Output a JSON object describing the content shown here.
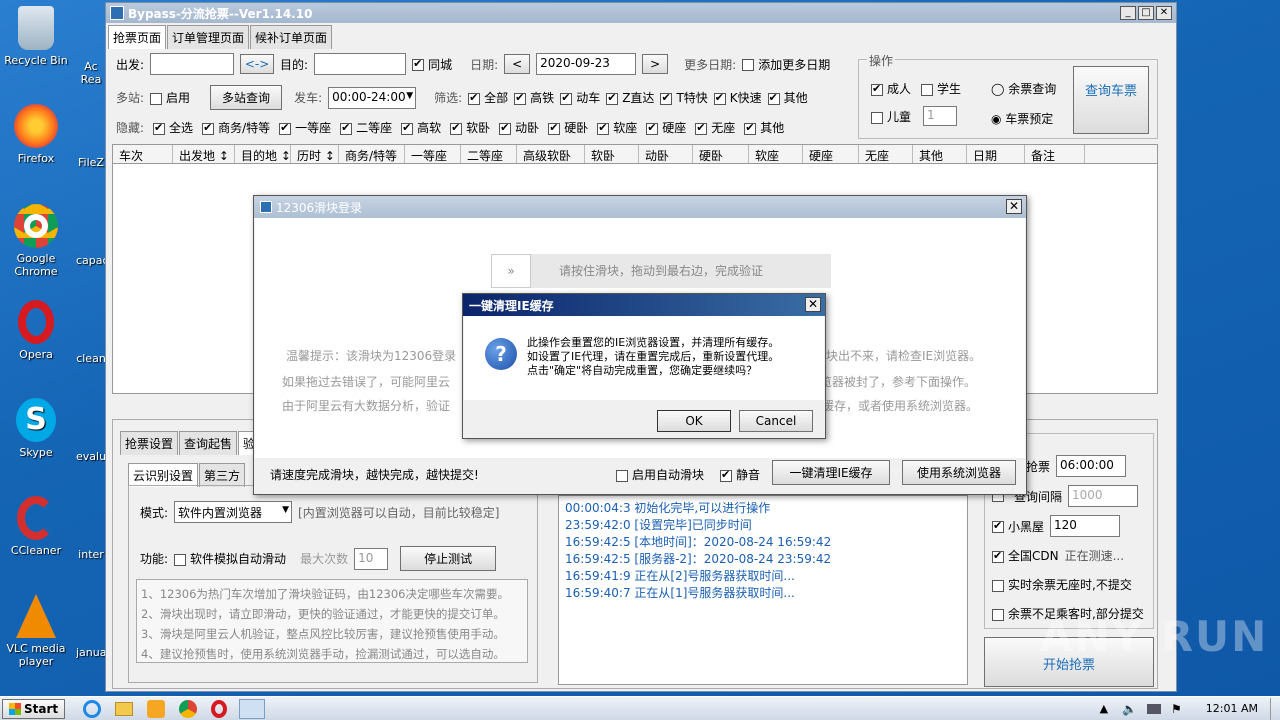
{
  "desktop": {
    "icons": [
      {
        "label": "Recycle Bin",
        "icon": "recycle-bin-icon"
      },
      {
        "label": "Firefox",
        "icon": "firefox-icon"
      },
      {
        "label": "Google Chrome",
        "icon": "chrome-icon"
      },
      {
        "label": "Opera",
        "icon": "opera-icon"
      },
      {
        "label": "Skype",
        "icon": "skype-icon"
      },
      {
        "label": "CCleaner",
        "icon": "ccleaner-icon"
      },
      {
        "label": "VLC media player",
        "icon": "vlc-icon"
      }
    ],
    "icons2": [
      "Ac Rea",
      "FileZ",
      "capac",
      "clean",
      "evalu",
      "inter",
      "janua"
    ]
  },
  "window": {
    "title": "Bypass-分流抢票--Ver1.14.10",
    "tabs": [
      "抢票页面",
      "订单管理页面",
      "候补订单页面"
    ]
  },
  "search": {
    "from_label": "出发:",
    "swap": "<->",
    "to_label": "目的:",
    "same_city": "同城",
    "date_label": "日期:",
    "date": "2020-09-23",
    "more_dates_label": "更多日期:",
    "add_more_dates": "添加更多日期",
    "multi_station": "多站:",
    "enable": "启用",
    "multi_query": "多站查询",
    "depart_label": "发车:",
    "depart_time": "00:00-24:00",
    "filter_label": "筛选:",
    "filters": [
      "全部",
      "高铁",
      "动车",
      "Z直达",
      "T特快",
      "K快速",
      "其他"
    ],
    "hide_label": "隐藏:",
    "hide_items": [
      "全选",
      "商务/特等",
      "一等座",
      "二等座",
      "高软",
      "软卧",
      "动卧",
      "硬卧",
      "软座",
      "硬座",
      "无座",
      "其他"
    ]
  },
  "ops": {
    "title": "操作",
    "adult": "成人",
    "student": "学生",
    "child": "儿童",
    "child_count": "1",
    "remain_query": "余票查询",
    "book": "车票预定",
    "query_btn": "查询车票"
  },
  "grid": {
    "columns": [
      "车次",
      "出发地 ↕",
      "目的地 ↕",
      "历时 ↕",
      "商务/特等",
      "一等座",
      "二等座",
      "高级软卧",
      "软卧",
      "动卧",
      "硬卧",
      "软座",
      "硬座",
      "无座",
      "其他",
      "日期",
      "备注"
    ]
  },
  "bottom": {
    "tabs": [
      "抢票设置",
      "查询起售",
      "验"
    ],
    "subtabs": [
      "云识别设置",
      "第三方"
    ],
    "mode_label": "模式:",
    "mode_value": "软件内置浏览器",
    "mode_note": "[内置浏览器可以自动，目前比较稳定]",
    "func_label": "功能:",
    "func_auto": "软件模拟自动滑动",
    "max_times_label": "最大次数",
    "max_times": "10",
    "stop_test": "停止测试",
    "notes": [
      "1、12306为热门车次增加了滑块验证码，由12306决定哪些车次需要。",
      "2、滑块出现时，请立即滑动，更快的验证通过，才能更快的提交订单。",
      "3、滑块是阿里云人机验证，整点风控比较厉害，建议抢预售使用手动。",
      "4、建议抢预售时，使用系统浏览器手动，捡漏测试通过，可以选自动。"
    ],
    "logs": [
      "00:00:04:3  初始化完毕,可以进行操作",
      "23:59:42:0  [设置完毕]已同步时间",
      "16:59:42:5  [本地时间]：2020-08-24 16:59:42",
      "16:59:42:5  [服务器-2]：2020-08-24 23:59:42",
      "16:59:41:9  正在从[2]号服务器获取时间...",
      "16:59:40:7  正在从[1]号服务器获取时间..."
    ],
    "right": {
      "grab_label": "抢票",
      "grab_time": "06:00:00",
      "interval_label": "查询间隔",
      "interval": "1000",
      "blackroom": "小黑屋",
      "blackroom_val": "120",
      "cdn": "全国CDN",
      "cdn_status": "正在测速...",
      "realtime": "实时余票无座时,不提交",
      "partial": "余票不足乘客时,部分提交",
      "start": "开始抢票"
    }
  },
  "slider": {
    "title": "12306滑块登录",
    "hint": "请按住滑块，拖动到最右边，完成验证",
    "tip1": "温馨提示：该滑块为12306登录",
    "tip1b": "块出不来，请检查IE浏览器。",
    "tip2": "如果拖过去错误了，可能阿里云",
    "tip2b": "览器被封了，参考下面操作。",
    "tip3": "由于阿里云有大数据分析，验证",
    "tip3b": "缓存，或者使用系统浏览器。",
    "footer": "请速度完成滑块，越快完成，越快提交!",
    "auto": "启用自动滑块",
    "mute": "静音",
    "clear_ie": "一键清理IE缓存",
    "sys_browser": "使用系统浏览器"
  },
  "dialog": {
    "title": "一键清理IE缓存",
    "msg": [
      "此操作会重置您的IE浏览器设置，并清理所有缓存。",
      "如设置了IE代理，请在重置完成后，重新设置代理。",
      "点击\"确定\"将自动完成重置，您确定要继续吗？"
    ],
    "ok": "OK",
    "cancel": "Cancel"
  },
  "taskbar": {
    "start": "Start",
    "clock": "12:01 AM"
  },
  "watermark": "ANY RUN"
}
